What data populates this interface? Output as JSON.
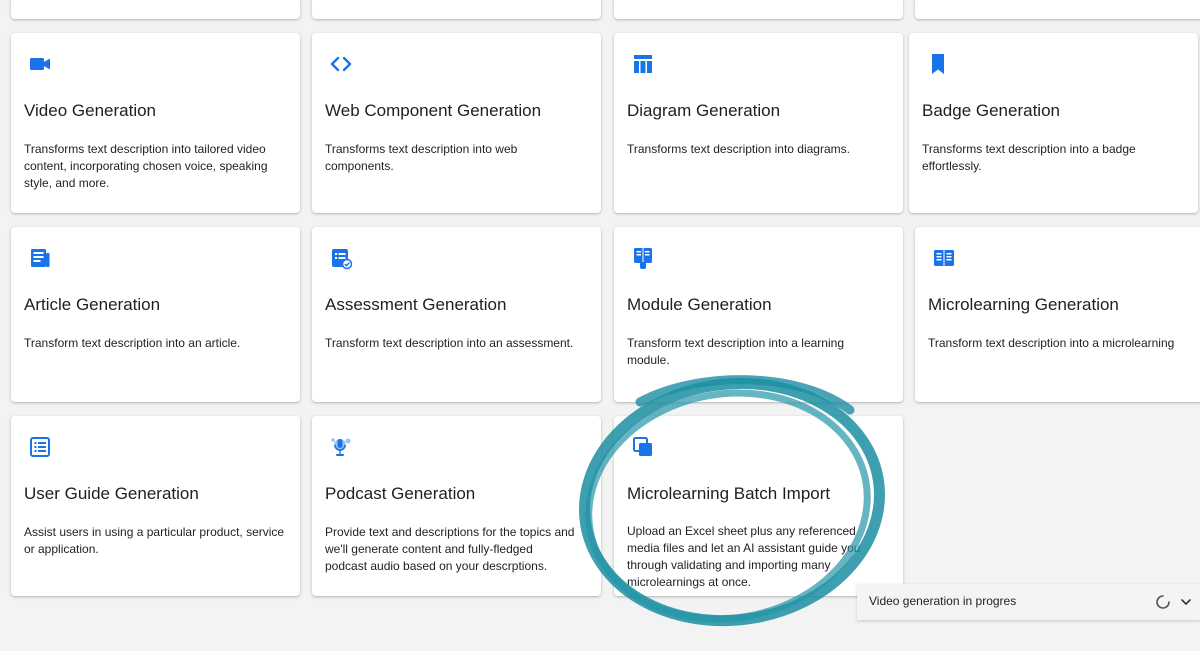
{
  "accent_color": "#1a73e8",
  "annotation_color": "#1c8ea2",
  "cards": [
    {
      "id": "video",
      "icon": "videocam-icon",
      "title": "Video Generation",
      "description": "Transforms text description into tailored video content, incorporating chosen voice, speaking style, and more."
    },
    {
      "id": "web-component",
      "icon": "code-icon",
      "title": "Web Component Generation",
      "description": "Transforms text description into web components."
    },
    {
      "id": "diagram",
      "icon": "table-layout-icon",
      "title": "Diagram Generation",
      "description": "Transforms text description into diagrams."
    },
    {
      "id": "badge",
      "icon": "bookmark-icon",
      "title": "Badge Generation",
      "description": "Transforms text description into a badge effortlessly."
    },
    {
      "id": "article",
      "icon": "article-icon",
      "title": "Article Generation",
      "description": "Transform text description into an article."
    },
    {
      "id": "assessment",
      "icon": "checklist-icon",
      "title": "Assessment Generation",
      "description": "Transform text description into an assessment."
    },
    {
      "id": "module",
      "icon": "book-module-icon",
      "title": "Module Generation",
      "description": "Transform text description into a learning module."
    },
    {
      "id": "microlearning",
      "icon": "book-open-icon",
      "title": "Microlearning Generation",
      "description": "Transform text description into a microlearning"
    },
    {
      "id": "user-guide",
      "icon": "list-icon",
      "title": "User Guide Generation",
      "description": "Assist users in using a particular product, service or application."
    },
    {
      "id": "podcast",
      "icon": "podcast-mic-icon",
      "title": "Podcast Generation",
      "description": "Provide text and descriptions for the topics and we'll generate content and fully-fledged podcast audio based on your descrptions."
    },
    {
      "id": "batch-import",
      "icon": "copy-stack-icon",
      "title": "Microlearning Batch Import",
      "description": "Upload an Excel sheet plus any referenced media files and let an AI assistant guide you through validating and importing many microlearnings at once."
    }
  ],
  "toast": {
    "text": "Video generation in progres",
    "spinner_icon": "loading-spinner-icon",
    "expand_icon": "chevron-down-icon"
  }
}
